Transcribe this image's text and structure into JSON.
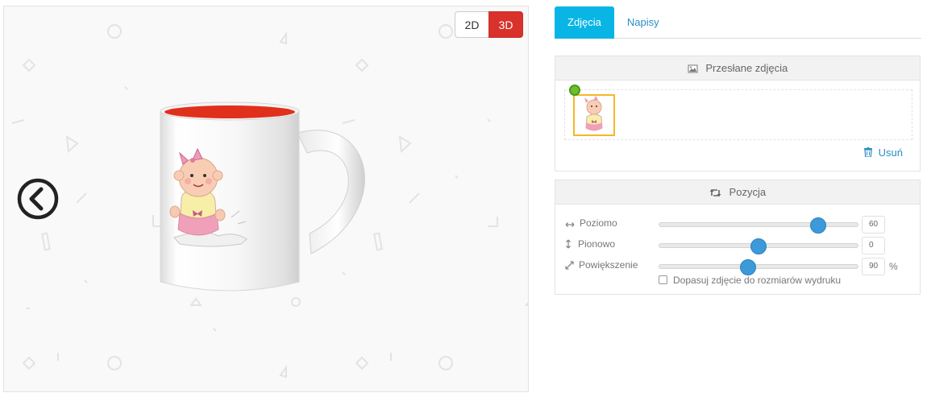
{
  "viewer": {
    "toggle_2d": "2D",
    "toggle_3d": "3D",
    "active_view": "3D",
    "accent_active": "#d9322b"
  },
  "tabs": [
    {
      "label": "Zdjęcia",
      "active": true
    },
    {
      "label": "Napisy",
      "active": false
    }
  ],
  "photos": {
    "title": "Przesłane zdjęcia",
    "remove_label": "Usuń"
  },
  "position": {
    "title": "Pozycja",
    "rows": [
      {
        "label": "Poziomo",
        "value": "60",
        "unit": ""
      },
      {
        "label": "Pionowo",
        "value": "0",
        "unit": ""
      },
      {
        "label": "Powiększenie",
        "value": "90",
        "unit": "%"
      }
    ],
    "fit_label": "Dopasuj zdjęcie do rozmiarów wydruku"
  },
  "colors": {
    "tab_active": "#08b5e5",
    "link": "#2a8fc4",
    "slider_knob": "#3d9ad9",
    "thumb_border": "#f5b72a",
    "mug_interior": "#e0301c"
  }
}
